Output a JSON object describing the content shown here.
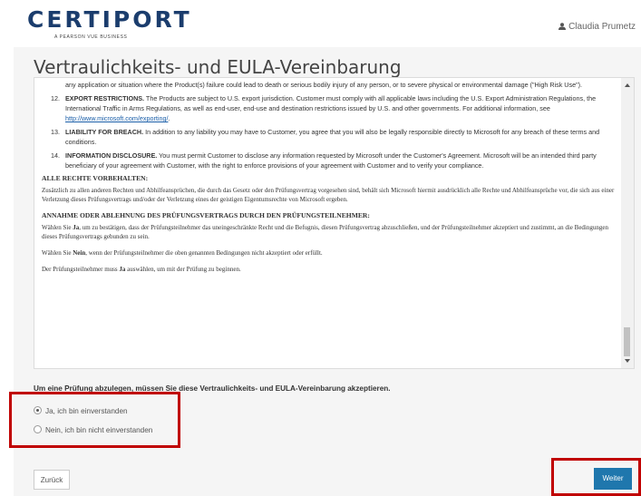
{
  "header": {
    "logo_text": "CERTIPORT",
    "logo_tagline": "A PEARSON VUE BUSINESS",
    "user_name": "Claudia Prumetz"
  },
  "page": {
    "title": "Vertraulichkeits- und EULA-Vereinbarung"
  },
  "agreement": {
    "first_item_text": "any application or situation where the Product(s) failure could lead to death or serious bodily injury of any person, or to severe physical or environmental damage (\"High Risk Use\").",
    "items": [
      {
        "num": "12.",
        "heading": "EXPORT RESTRICTIONS.",
        "text": " The Products are subject to U.S. export jurisdiction. Customer must comply with all applicable laws including the U.S. Export Administration Regulations, the International Traffic in Arms Regulations, as well as end-user, end-use and destination restrictions issued by U.S. and other governments. For additional information, see ",
        "link": "http://www.microsoft.com/exporting/",
        "tail": "."
      },
      {
        "num": "13.",
        "heading": "LIABILITY FOR BREACH.",
        "text": " In addition to any liability you may have to Customer, you agree that you will also be legally responsible directly to Microsoft for any breach of these terms and conditions."
      },
      {
        "num": "14.",
        "heading": "INFORMATION DISCLOSURE.",
        "text": " You must permit Customer to disclose any information requested by Microsoft under the Customer's Agreement. Microsoft will be an intended third party beneficiary of your agreement with Customer, with the right to enforce provisions of your agreement with Customer and to verify your compliance."
      }
    ],
    "rights_heading": "ALLE RECHTE VORBEHALTEN:",
    "rights_text": "Zusätzlich zu allen anderen Rechten und Abhilfeansprüchen, die durch das Gesetz oder den Prüfungsvertrag vorgesehen sind, behält sich Microsoft hiermit ausdrücklich alle Rechte und Abhilfeansprüche vor, die sich aus einer Verletzung dieses Prüfungsvertrags und/oder der Verletzung eines der geistigen Eigentumsrechte von Microsoft ergeben.",
    "accept_heading": "ANNAHME ODER ABLEHNUNG DES PRÜFUNGSVERTRAGS DURCH DEN PRÜFUNGSTEILNEHMER:",
    "accept_p1_a": "Wählen Sie ",
    "accept_p1_b": "Ja",
    "accept_p1_c": ", um zu bestätigen, dass der Prüfungsteilnehmer das uneingeschränkte Recht und die Befugnis, diesen Prüfungsvertrag abzuschließen, und der Prüfungsteilnehmer akzeptiert und zustimmt, an die Bedingungen dieses Prüfungsvertrags gebunden zu sein.",
    "accept_p2_a": "Wählen Sie ",
    "accept_p2_b": "Nein",
    "accept_p2_c": ", wenn der Prüfungsteilnehmer die oben genannten Bedingungen nicht akzeptiert oder erfüllt.",
    "accept_p3_a": "Der Prüfungsteilnehmer muss ",
    "accept_p3_b": "Ja",
    "accept_p3_c": " auswählen, um mit der Prüfung zu beginnen."
  },
  "form": {
    "prompt": "Um eine Prüfung abzulegen, müssen Sie diese Vertraulichkeits- und EULA-Vereinbarung akzeptieren.",
    "option_yes": "Ja, ich bin einverstanden",
    "option_no": "Nein, ich bin nicht einverstanden",
    "selected": "yes"
  },
  "buttons": {
    "back": "Zurück",
    "next": "Weiter"
  },
  "colors": {
    "brand": "#1b3d6d",
    "primary_button": "#1f77ad",
    "highlight": "#c00000"
  }
}
